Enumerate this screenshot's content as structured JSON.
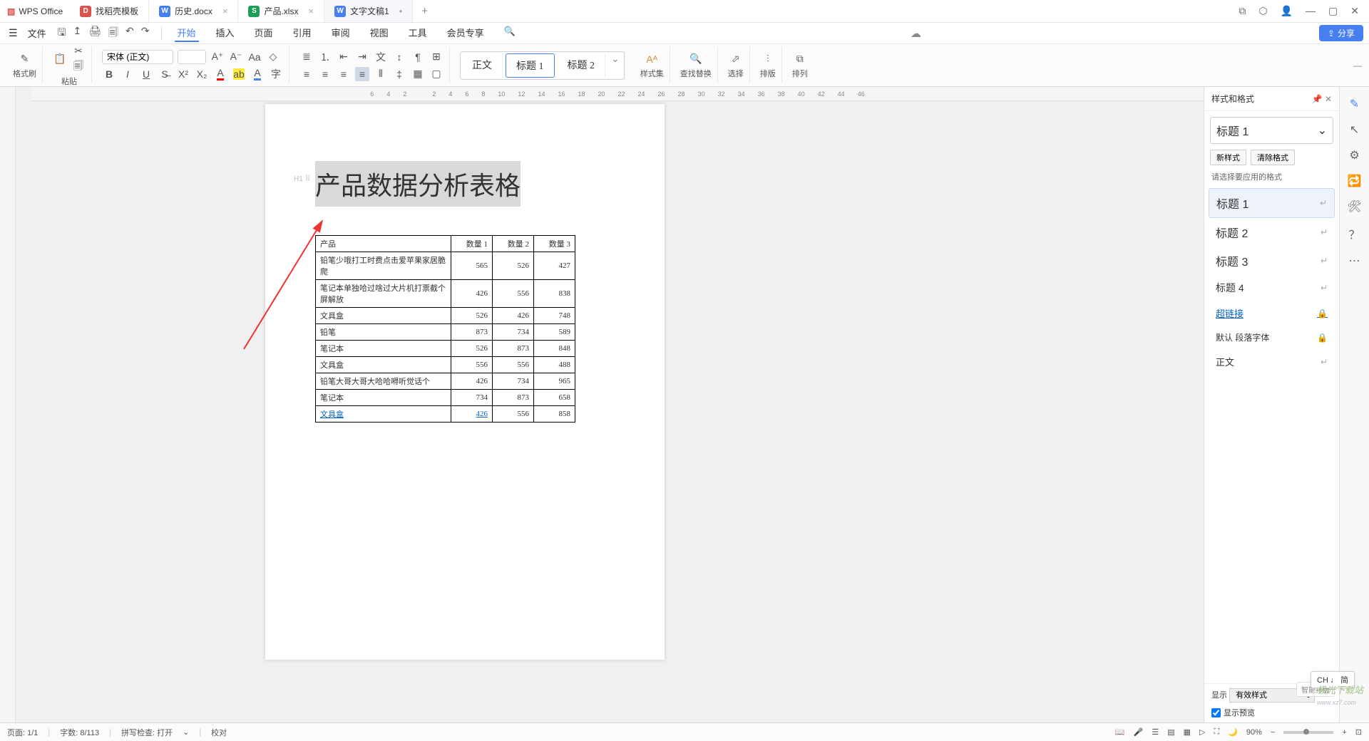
{
  "app": {
    "name": "WPS Office"
  },
  "tabs": [
    {
      "label": "找稻壳模板",
      "icon_bg": "#d9534f",
      "icon_txt": "D"
    },
    {
      "label": "历史.docx",
      "icon_bg": "#467ff2",
      "icon_txt": "W"
    },
    {
      "label": "产品.xlsx",
      "icon_bg": "#1e9e54",
      "icon_txt": "S"
    },
    {
      "label": "文字文稿1",
      "icon_bg": "#467ff2",
      "icon_txt": "W",
      "active": true
    }
  ],
  "file_menu": "文件",
  "menus": [
    "开始",
    "插入",
    "页面",
    "引用",
    "审阅",
    "视图",
    "工具",
    "会员专享"
  ],
  "share": "分享",
  "ribbon": {
    "format_painter": "格式刷",
    "paste": "粘贴",
    "font_name": "宋体 (正文)",
    "font_size": "",
    "styles_btn": "样式集",
    "find": "查找替换",
    "select": "选择",
    "layout": "排版",
    "arrange": "排列",
    "style_items": [
      "正文",
      "标题 1",
      "标题 2"
    ]
  },
  "ruler_ticks": [
    "6",
    "4",
    "2",
    "",
    "2",
    "4",
    "6",
    "8",
    "10",
    "12",
    "14",
    "16",
    "18",
    "20",
    "22",
    "24",
    "26",
    "28",
    "30",
    "32",
    "34",
    "36",
    "38",
    "40",
    "42",
    "44",
    "46"
  ],
  "doc": {
    "title": "产品数据分析表格",
    "h_indicator": "H1",
    "headers": [
      "产品",
      "数量 1",
      "数量 2",
      "数量 3"
    ],
    "rows": [
      {
        "p": "铅笔少哦打工时费点击爱苹果家居脆爬",
        "a": "565",
        "b": "526",
        "c": "427"
      },
      {
        "p": "笔记本单独哈过啥过大片机打票截个屏解放",
        "a": "426",
        "b": "556",
        "c": "838"
      },
      {
        "p": "文具盒",
        "a": "526",
        "b": "426",
        "c": "748"
      },
      {
        "p": "铅笔",
        "a": "873",
        "b": "734",
        "c": "589"
      },
      {
        "p": "笔记本",
        "a": "526",
        "b": "873",
        "c": "848"
      },
      {
        "p": "文具盒",
        "a": "556",
        "b": "556",
        "c": "488"
      },
      {
        "p": "铅笔大哥大哥大哈哈嘚听觉话个",
        "a": "426",
        "b": "734",
        "c": "965"
      },
      {
        "p": "笔记本",
        "a": "734",
        "b": "873",
        "c": "658"
      },
      {
        "p": "文具盒",
        "a": "426",
        "b": "556",
        "c": "858",
        "link": true
      }
    ]
  },
  "style_panel": {
    "title": "样式和格式",
    "current": "标题 1",
    "new_btn": "新样式",
    "clear_btn": "清除格式",
    "hint": "请选择要应用的格式",
    "items": [
      "标题 1",
      "标题 2",
      "标题 3",
      "标题 4"
    ],
    "extra": [
      {
        "label": "超链接",
        "type": "link"
      },
      {
        "label": "默认 段落字体",
        "type": "lock"
      },
      {
        "label": "正文",
        "type": "ret"
      }
    ],
    "show_label": "显示",
    "show_value": "有效样式",
    "preview_chk": "显示预览",
    "smart": "智能排版"
  },
  "status": {
    "page": "页面: 1/1",
    "words": "字数: 8/113",
    "spell": "拼写检查: 打开",
    "mode": "校对",
    "zoom": "90%"
  },
  "ime": "CH ♩ 简",
  "watermark": "极光下载站"
}
